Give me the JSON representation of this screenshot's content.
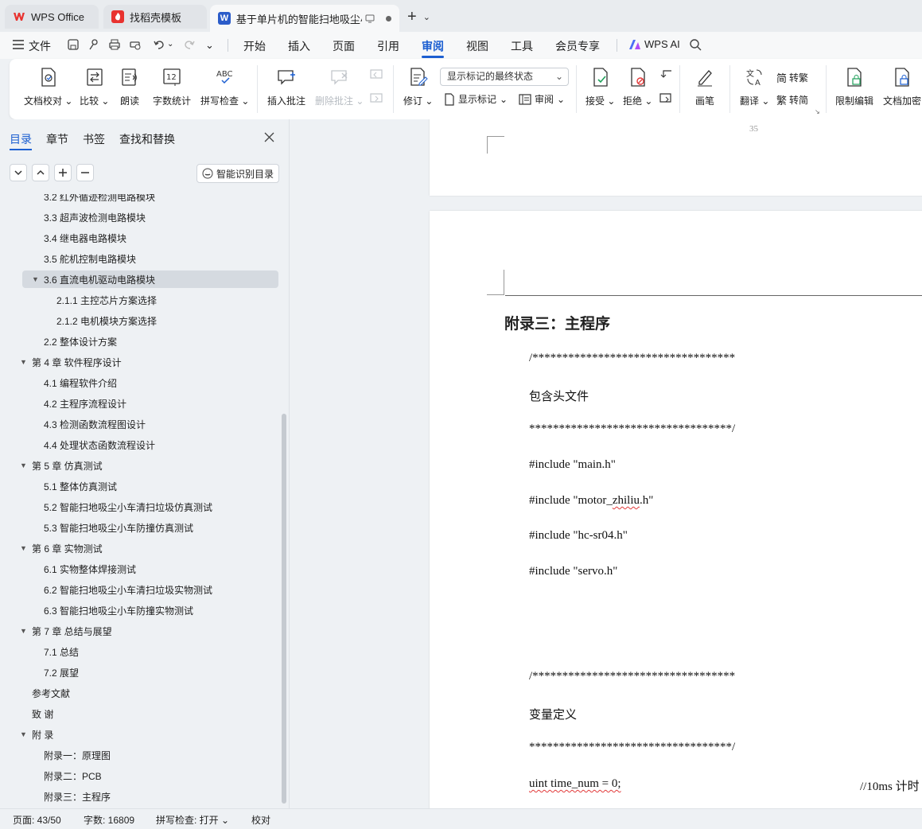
{
  "tabs": [
    {
      "label": "WPS Office"
    },
    {
      "label": "找稻壳模板"
    },
    {
      "label": "基于单片机的智能扫地吸尘小车"
    }
  ],
  "menubar": {
    "file_label": "文件",
    "items": [
      "开始",
      "插入",
      "页面",
      "引用",
      "审阅",
      "视图",
      "工具",
      "会员专享"
    ],
    "active": "审阅",
    "ai_label": "WPS AI"
  },
  "ribbon": {
    "doc_check": "文档校对",
    "compare": "比较",
    "read_aloud": "朗读",
    "word_count": "字数统计",
    "spell_check": "拼写检查",
    "insert_comment": "插入批注",
    "delete_comment": "删除批注",
    "track": "修订",
    "display_select": "显示标记的最终状态",
    "show_markup": "显示标记",
    "review": "审阅",
    "accept": "接受",
    "reject": "拒绝",
    "pen": "画笔",
    "translate": "翻译",
    "to_traditional": "转繁",
    "to_simplified": "转简",
    "restrict_edit": "限制编辑",
    "encrypt": "文档加密"
  },
  "leftpane": {
    "tabs": [
      "目录",
      "章节",
      "书签",
      "查找和替换"
    ],
    "smart_toc": "智能识别目录",
    "toc": [
      {
        "label": "3.2  红外循迹检测电路模块",
        "level": 2
      },
      {
        "label": "3.3 超声波检测电路模块",
        "level": 2
      },
      {
        "label": "3.4  继电器电路模块",
        "level": 2
      },
      {
        "label": "3.5  舵机控制电路模块",
        "level": 2
      },
      {
        "label": "3.6  直流电机驱动电路模块",
        "level": 2,
        "selected": true,
        "expanded": true
      },
      {
        "label": "2.1.1  主控芯片方案选择",
        "level": 3
      },
      {
        "label": "2.1.2  电机模块方案选择",
        "level": 3
      },
      {
        "label": "2.2  整体设计方案",
        "level": 2
      },
      {
        "label": "第 4 章  软件程序设计",
        "level": 1,
        "expanded": true
      },
      {
        "label": "4.1  编程软件介绍",
        "level": 2
      },
      {
        "label": "4.2  主程序流程设计",
        "level": 2
      },
      {
        "label": "4.3  检测函数流程图设计",
        "level": 2
      },
      {
        "label": "4.4  处理状态函数流程设计",
        "level": 2
      },
      {
        "label": "第 5 章  仿真测试",
        "level": 1,
        "expanded": true
      },
      {
        "label": "5.1  整体仿真测试",
        "level": 2
      },
      {
        "label": "5.2  智能扫地吸尘小车清扫垃圾仿真测试",
        "level": 2
      },
      {
        "label": "5.3  智能扫地吸尘小车防撞仿真测试",
        "level": 2
      },
      {
        "label": "第 6 章  实物测试",
        "level": 1,
        "expanded": true
      },
      {
        "label": "6.1  实物整体焊接测试",
        "level": 2
      },
      {
        "label": "6.2  智能扫地吸尘小车清扫垃圾实物测试",
        "level": 2
      },
      {
        "label": "6.3  智能扫地吸尘小车防撞实物测试",
        "level": 2
      },
      {
        "label": "第 7 章  总结与展望",
        "level": 1,
        "expanded": true
      },
      {
        "label": "7.1  总结",
        "level": 2
      },
      {
        "label": "7.2  展望",
        "level": 2
      },
      {
        "label": "参考文献",
        "level": 1
      },
      {
        "label": "致    谢",
        "level": 1
      },
      {
        "label": "附    录",
        "level": 1,
        "expanded": true
      },
      {
        "label": "附录一：原理图",
        "level": 2
      },
      {
        "label": "附录二：PCB",
        "level": 2
      },
      {
        "label": "附录三：主程序",
        "level": 2
      }
    ]
  },
  "document": {
    "page_number": "35",
    "heading": "附录三：主程序",
    "lines": [
      "/**********************************",
      "包含头文件",
      "**********************************/",
      "#include \"main.h\"",
      "#include \"motor_zhiliu.h\"",
      "#include \"hc-sr04.h\"",
      "#include \"servo.h\"",
      "/**********************************",
      "变量定义",
      "**********************************/",
      "uint time_num = 0;",
      "//10ms 计时"
    ]
  },
  "statusbar": {
    "page": "页面: 43/50",
    "words": "字数: 16809",
    "spell": "拼写检查: 打开",
    "proof": "校对"
  },
  "colors": {
    "accent": "#1c5fd1",
    "wps_red": "#e8322f",
    "doc_blue": "#2b5cc9"
  }
}
